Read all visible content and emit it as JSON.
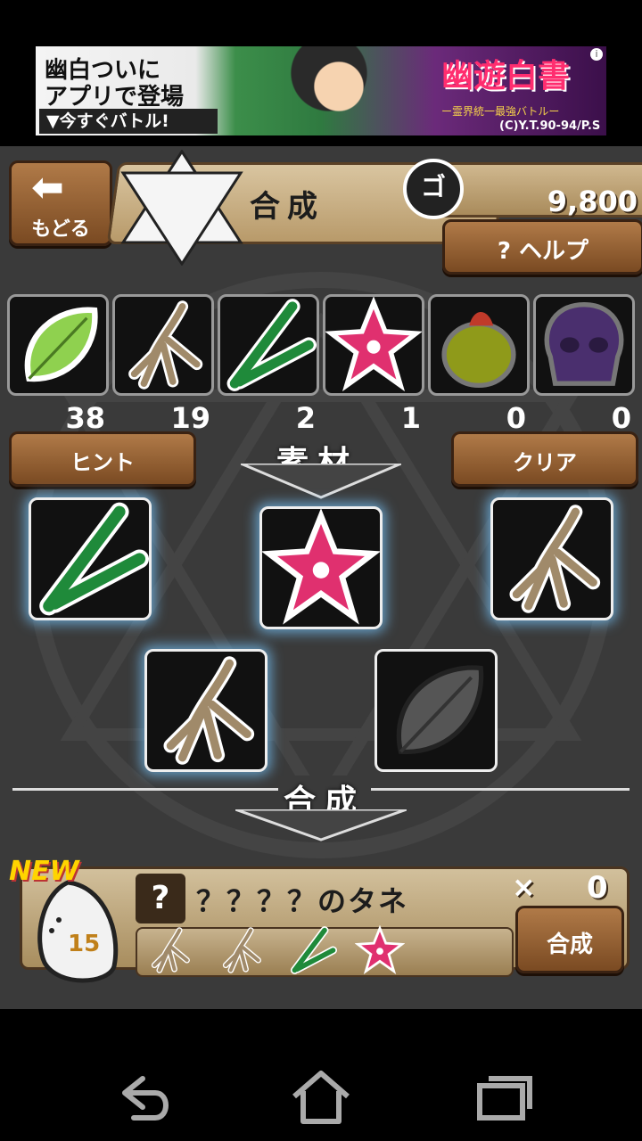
{
  "ad": {
    "line1": "幽白ついに",
    "line2": "アプリで登場",
    "cta": "▼今すぐバトル!",
    "logo": "幽遊白書",
    "subtitle": "ー霊界統一最強バトルー",
    "copyright": "(C)Y.T.90-94/P.S",
    "info": "i"
  },
  "header": {
    "back_label": "もどる",
    "title": "合成",
    "gold_icon": "ゴ",
    "gold_value": "9,800",
    "help_label": "? ヘルプ"
  },
  "inventory": [
    {
      "item": "leaf",
      "count": "38"
    },
    {
      "item": "root",
      "count": "19"
    },
    {
      "item": "grass",
      "count": "2"
    },
    {
      "item": "flower",
      "count": "1"
    },
    {
      "item": "bulb",
      "count": "0"
    },
    {
      "item": "skull",
      "count": "0"
    }
  ],
  "materials": {
    "hint_label": "ヒント",
    "section_label": "素材",
    "clear_label": "クリア",
    "slots": [
      "grass",
      "flower",
      "root",
      "root",
      "empty-leaf"
    ]
  },
  "synthesis": {
    "section_label": "合成",
    "new_badge": "NEW",
    "seed_number": "15",
    "q_mark": "?",
    "result_name": "？？？？のタネ",
    "times": "×",
    "count": "0",
    "recipe": [
      "root",
      "root",
      "grass",
      "flower"
    ],
    "button_label": "合成"
  },
  "colors": {
    "wood": "#8b5a2b",
    "parchment": "#c9b28a",
    "background": "#3a3a3a",
    "slot_glow": "#78c8ff"
  },
  "icons": {
    "back": "left-arrow-icon",
    "nav_back": "back-icon",
    "nav_home": "home-icon",
    "nav_recent": "recent-apps-icon"
  }
}
